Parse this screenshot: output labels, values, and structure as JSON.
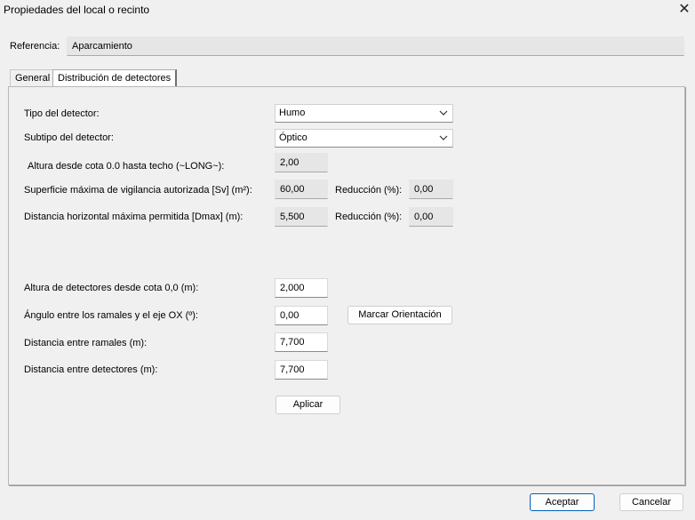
{
  "window": {
    "title": "Propiedades del local o recinto",
    "close_glyph": "✕"
  },
  "referencia": {
    "label": "Referencia:",
    "value": "Aparcamiento"
  },
  "tabs": [
    {
      "label": "General",
      "active": false
    },
    {
      "label": "Distribución de detectores",
      "active": true
    }
  ],
  "form": {
    "tipo": {
      "label": "Tipo del detector:",
      "value": "Humo"
    },
    "subtipo": {
      "label": "Subtipo del detector:",
      "value": "Óptico"
    },
    "altura_techo": {
      "label": "Altura desde cota 0.0 hasta techo (~LONG~):",
      "value": "2,00"
    },
    "superficie": {
      "label": "Superficie máxima de vigilancia autorizada [Sv] (m²):",
      "value": "60,00",
      "reduccion_label": "Reducción (%):",
      "reduccion_value": "0,00"
    },
    "distancia_max": {
      "label": "Distancia horizontal máxima permitida [Dmax] (m):",
      "value": "5,500",
      "reduccion_label": "Reducción (%):",
      "reduccion_value": "0,00"
    },
    "altura_detectores": {
      "label": "Altura de detectores desde cota 0,0 (m):",
      "value": "2,000"
    },
    "angulo": {
      "label": "Ángulo entre los ramales y el eje OX (º):",
      "value": "0,00",
      "button": "Marcar Orientación"
    },
    "dist_ramales": {
      "label": "Distancia entre ramales (m):",
      "value": "7,700"
    },
    "dist_detectores": {
      "label": "Distancia entre detectores (m):",
      "value": "7,700"
    },
    "aplicar": "Aplicar"
  },
  "footer": {
    "ok": "Aceptar",
    "cancel": "Cancelar"
  },
  "colors": {
    "accent": "#005fb8",
    "window_bg": "#f0f0f0",
    "readonly_bg": "#e6e6e6"
  }
}
